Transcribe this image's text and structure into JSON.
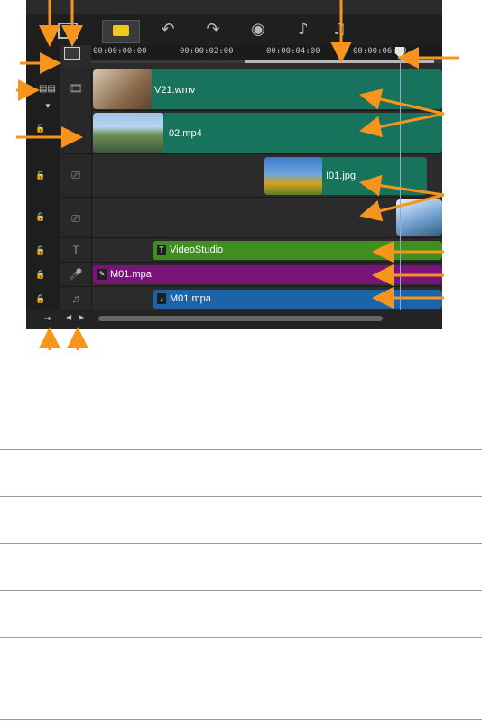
{
  "toolbar": {
    "icons": [
      "timeline-view-icon",
      "storyboard-view-icon",
      "undo-icon",
      "redo-icon",
      "record-capture-icon",
      "sound-mixer-icon",
      "auto-music-icon"
    ]
  },
  "ruler": {
    "timecodes": [
      "00:00:00:00",
      "00:00:02:00",
      "00:00:04:00",
      "00:00:06:00"
    ]
  },
  "tracks": {
    "video": {
      "clip1_label": "V21.wmv",
      "clip2_label": "02.mp4"
    },
    "overlay1": {
      "clip_label": "I01.jpg"
    },
    "title": {
      "clip_label": "VideoStudio",
      "clip_icon": "T"
    },
    "voice": {
      "clip_label": "M01.mpa"
    },
    "music": {
      "clip_label": "M01.mpa"
    }
  },
  "colors": {
    "video_clip": "#17735c",
    "title_clip": "#3f8f1f",
    "voice_clip": "#7a137a",
    "music_clip": "#1c63a8",
    "annotation_arrow": "#f7941d"
  }
}
